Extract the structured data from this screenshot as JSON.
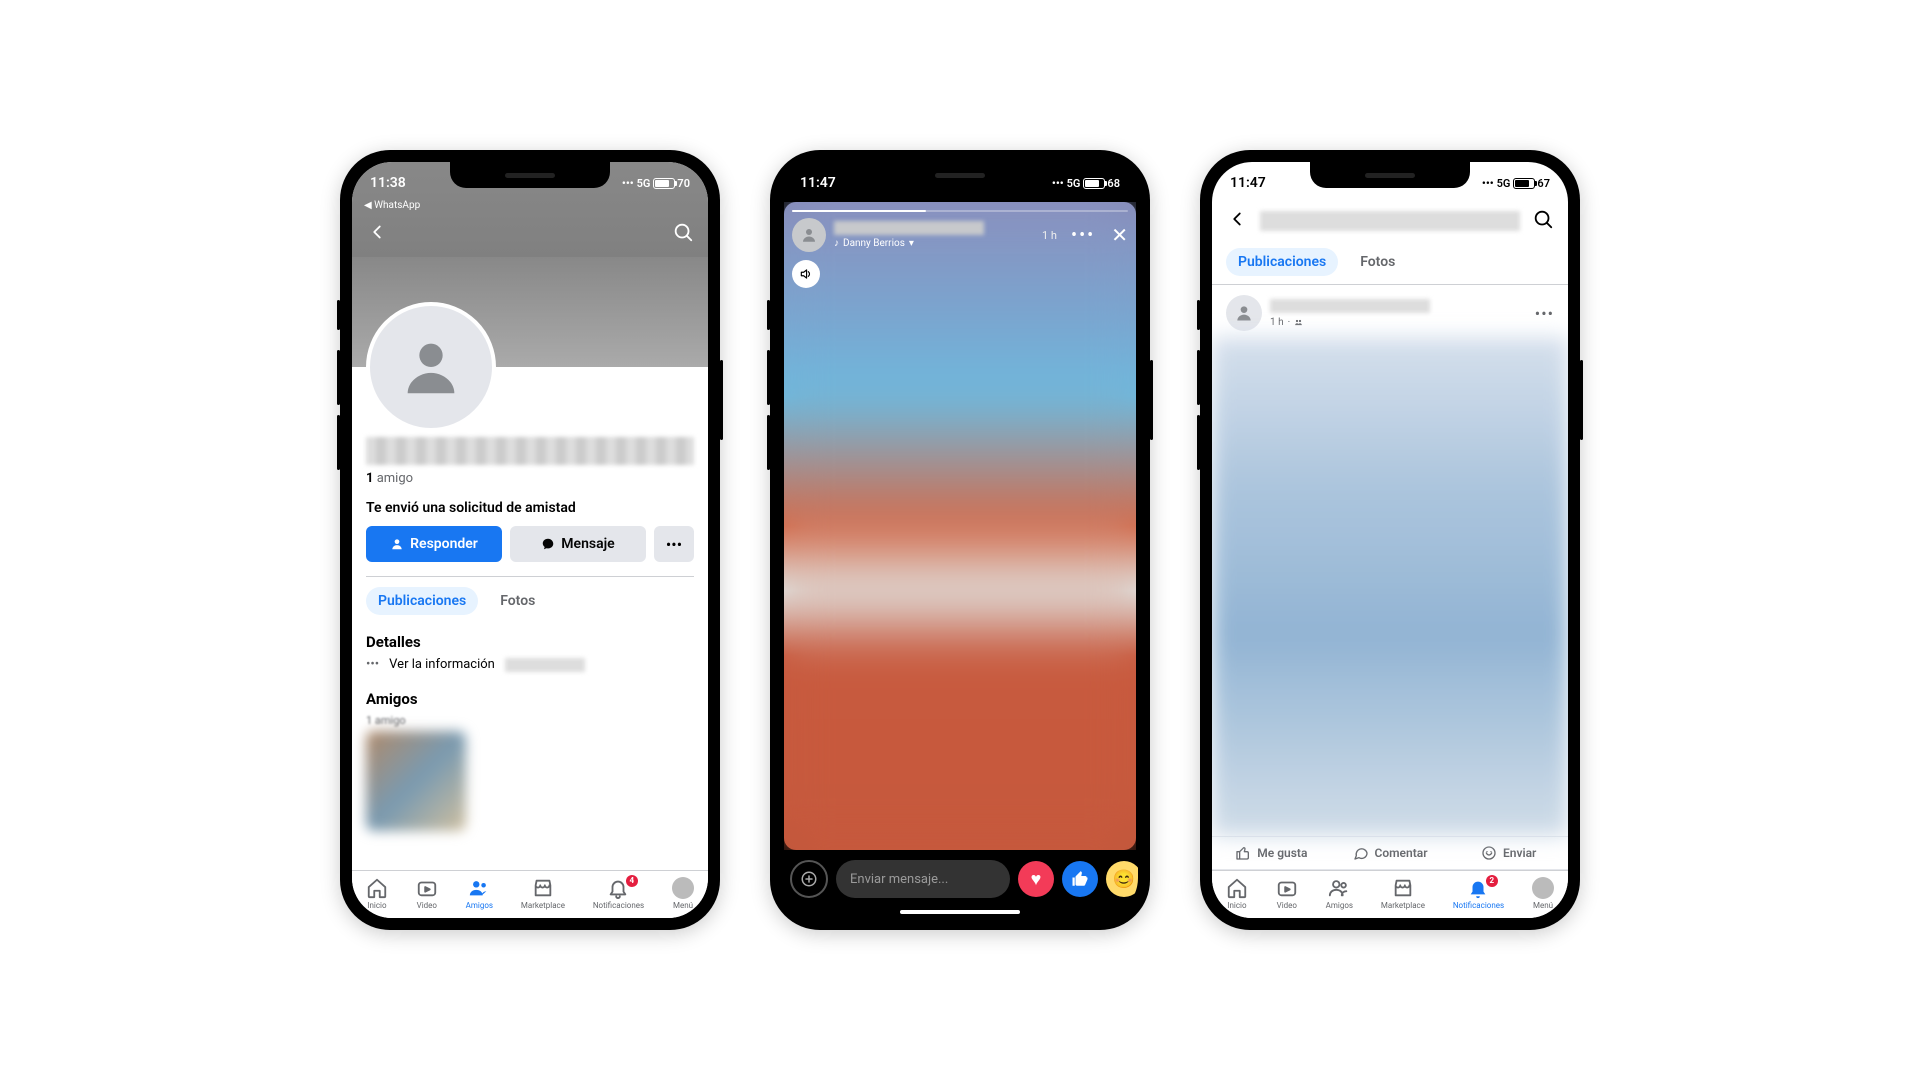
{
  "phone1": {
    "status": {
      "time": "11:38",
      "net": "5G",
      "battery": "70",
      "back_app": "WhatsApp"
    },
    "friends": {
      "count": "1",
      "label": "amigo"
    },
    "request_text": "Te envió una solicitud de amistad",
    "buttons": {
      "respond": "Responder",
      "message": "Mensaje"
    },
    "tabs": {
      "posts": "Publicaciones",
      "photos": "Fotos"
    },
    "details": {
      "header": "Detalles",
      "see_info": "Ver la información"
    },
    "friends_section": {
      "header": "Amigos"
    },
    "nav": {
      "home": "Inicio",
      "video": "Video",
      "friends": "Amigos",
      "marketplace": "Marketplace",
      "notifications": "Notificaciones",
      "menu": "Menú",
      "badge": "4"
    }
  },
  "phone2": {
    "status": {
      "time": "11:47",
      "net": "5G",
      "battery": "68"
    },
    "story": {
      "time": "1 h",
      "music_label": "Danny Berrios"
    },
    "message_placeholder": "Enviar mensaje..."
  },
  "phone3": {
    "status": {
      "time": "11:47",
      "net": "5G",
      "battery": "67"
    },
    "tabs": {
      "posts": "Publicaciones",
      "photos": "Fotos"
    },
    "post": {
      "time": "1 h"
    },
    "actions": {
      "like": "Me gusta",
      "comment": "Comentar",
      "send": "Enviar"
    },
    "nav": {
      "home": "Inicio",
      "video": "Video",
      "friends": "Amigos",
      "marketplace": "Marketplace",
      "notifications": "Notificaciones",
      "menu": "Menú",
      "badge": "2"
    }
  }
}
